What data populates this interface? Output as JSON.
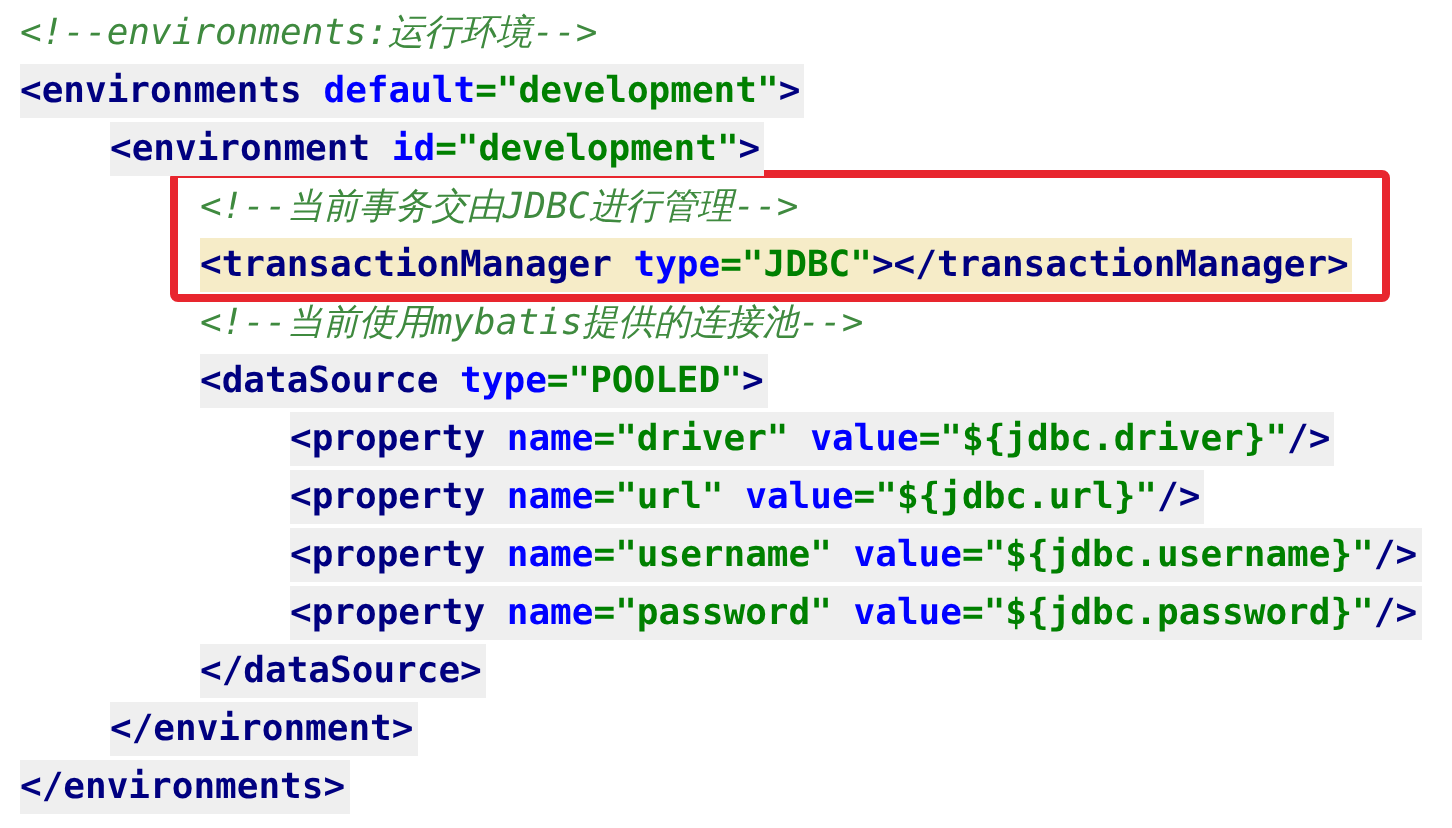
{
  "tree": [
    {
      "kind": "comment",
      "current": false,
      "tokens": [
        {
          "kind": "comment",
          "text": "<!--environments:运行环境-->"
        }
      ]
    },
    {
      "kind": "element",
      "current": false,
      "tokens": [
        {
          "kind": "tag",
          "text": "<environments"
        },
        {
          "kind": "attr",
          "text": " default"
        },
        {
          "kind": "value",
          "text": "=\"development\""
        },
        {
          "kind": "tag",
          "text": ">"
        }
      ],
      "closing": {
        "current": false,
        "tokens": [
          {
            "kind": "tag",
            "text": "</environments>"
          }
        ]
      },
      "children": [
        {
          "kind": "element",
          "current": false,
          "tokens": [
            {
              "kind": "tag",
              "text": "<environment"
            },
            {
              "kind": "attr",
              "text": " id"
            },
            {
              "kind": "value",
              "text": "=\"development\""
            },
            {
              "kind": "tag",
              "text": ">"
            }
          ],
          "closing": {
            "current": false,
            "tokens": [
              {
                "kind": "tag",
                "text": "</environment>"
              }
            ]
          },
          "children": [
            {
              "kind": "frame",
              "children": [
                {
                  "kind": "comment",
                  "current": false,
                  "tokens": [
                    {
                      "kind": "comment",
                      "text": "<!--当前事务交由JDBC进行管理-->"
                    }
                  ]
                },
                {
                  "kind": "element",
                  "current": true,
                  "tokens": [
                    {
                      "kind": "tag",
                      "text": "<transactionManager"
                    },
                    {
                      "kind": "attr",
                      "text": " type"
                    },
                    {
                      "kind": "value",
                      "text": "=\"JDBC\""
                    },
                    {
                      "kind": "tag",
                      "text": "></transactionManager>"
                    }
                  ]
                }
              ]
            },
            {
              "kind": "comment",
              "current": false,
              "tokens": [
                {
                  "kind": "comment",
                  "text": "<!--当前使用mybatis提供的连接池-->"
                }
              ]
            },
            {
              "kind": "element",
              "current": false,
              "tokens": [
                {
                  "kind": "tag",
                  "text": "<dataSource"
                },
                {
                  "kind": "attr",
                  "text": " type"
                },
                {
                  "kind": "value",
                  "text": "=\"POOLED\""
                },
                {
                  "kind": "tag",
                  "text": ">"
                }
              ],
              "closing": {
                "current": false,
                "tokens": [
                  {
                    "kind": "tag",
                    "text": "</dataSource>"
                  }
                ]
              },
              "children": [
                {
                  "kind": "element",
                  "current": false,
                  "tokens": [
                    {
                      "kind": "tag",
                      "text": "<property"
                    },
                    {
                      "kind": "attr",
                      "text": " name"
                    },
                    {
                      "kind": "value",
                      "text": "=\"driver\""
                    },
                    {
                      "kind": "attr",
                      "text": " value"
                    },
                    {
                      "kind": "value",
                      "text": "=\"${jdbc.driver}\""
                    },
                    {
                      "kind": "tag",
                      "text": "/>"
                    }
                  ]
                },
                {
                  "kind": "element",
                  "current": false,
                  "tokens": [
                    {
                      "kind": "tag",
                      "text": "<property"
                    },
                    {
                      "kind": "attr",
                      "text": " name"
                    },
                    {
                      "kind": "value",
                      "text": "=\"url\""
                    },
                    {
                      "kind": "attr",
                      "text": " value"
                    },
                    {
                      "kind": "value",
                      "text": "=\"${jdbc.url}\""
                    },
                    {
                      "kind": "tag",
                      "text": "/>"
                    }
                  ]
                },
                {
                  "kind": "element",
                  "current": false,
                  "tokens": [
                    {
                      "kind": "tag",
                      "text": "<property"
                    },
                    {
                      "kind": "attr",
                      "text": " name"
                    },
                    {
                      "kind": "value",
                      "text": "=\"username\""
                    },
                    {
                      "kind": "attr",
                      "text": " value"
                    },
                    {
                      "kind": "value",
                      "text": "=\"${jdbc.username}\""
                    },
                    {
                      "kind": "tag",
                      "text": "/>"
                    }
                  ]
                },
                {
                  "kind": "element",
                  "current": false,
                  "tokens": [
                    {
                      "kind": "tag",
                      "text": "<property"
                    },
                    {
                      "kind": "attr",
                      "text": " name"
                    },
                    {
                      "kind": "value",
                      "text": "=\"password\""
                    },
                    {
                      "kind": "attr",
                      "text": " value"
                    },
                    {
                      "kind": "value",
                      "text": "=\"${jdbc.password}\""
                    },
                    {
                      "kind": "tag",
                      "text": "/>"
                    }
                  ]
                }
              ]
            }
          ]
        }
      ]
    }
  ]
}
